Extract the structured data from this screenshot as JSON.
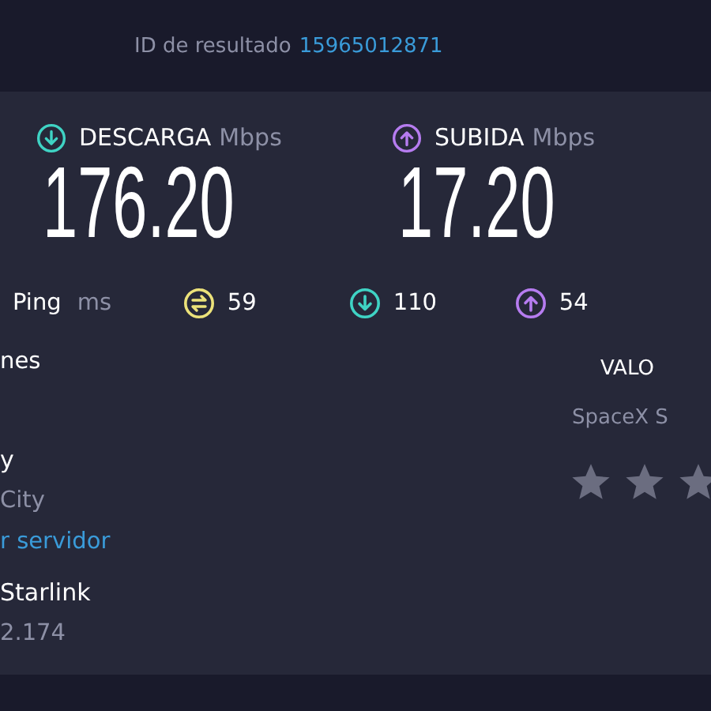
{
  "header": {
    "result_id_label": "ID de resultado",
    "result_id": "15965012871"
  },
  "speeds": [
    {
      "kind": "download",
      "label": "DESCARGA",
      "unit": "Mbps",
      "value": "176.20"
    },
    {
      "kind": "upload",
      "label": "SUBIDA",
      "unit": "Mbps",
      "value": "17.20"
    }
  ],
  "ping": {
    "label": "Ping",
    "unit": "ms",
    "values": [
      {
        "kind": "idle",
        "value": "59"
      },
      {
        "kind": "download",
        "value": "110"
      },
      {
        "kind": "upload",
        "value": "54"
      }
    ]
  },
  "details": [
    {
      "kind": "heading",
      "text": "nes"
    },
    {
      "kind": "title",
      "text": "y"
    },
    {
      "kind": "subtitle",
      "text": "City"
    },
    {
      "kind": "link",
      "text": "r servidor"
    },
    {
      "kind": "title",
      "text": "Starlink"
    },
    {
      "kind": "subtitle",
      "text": "2.174"
    }
  ],
  "rating": {
    "title": "VALO",
    "provider": "SpaceX S",
    "stars": 0
  }
}
